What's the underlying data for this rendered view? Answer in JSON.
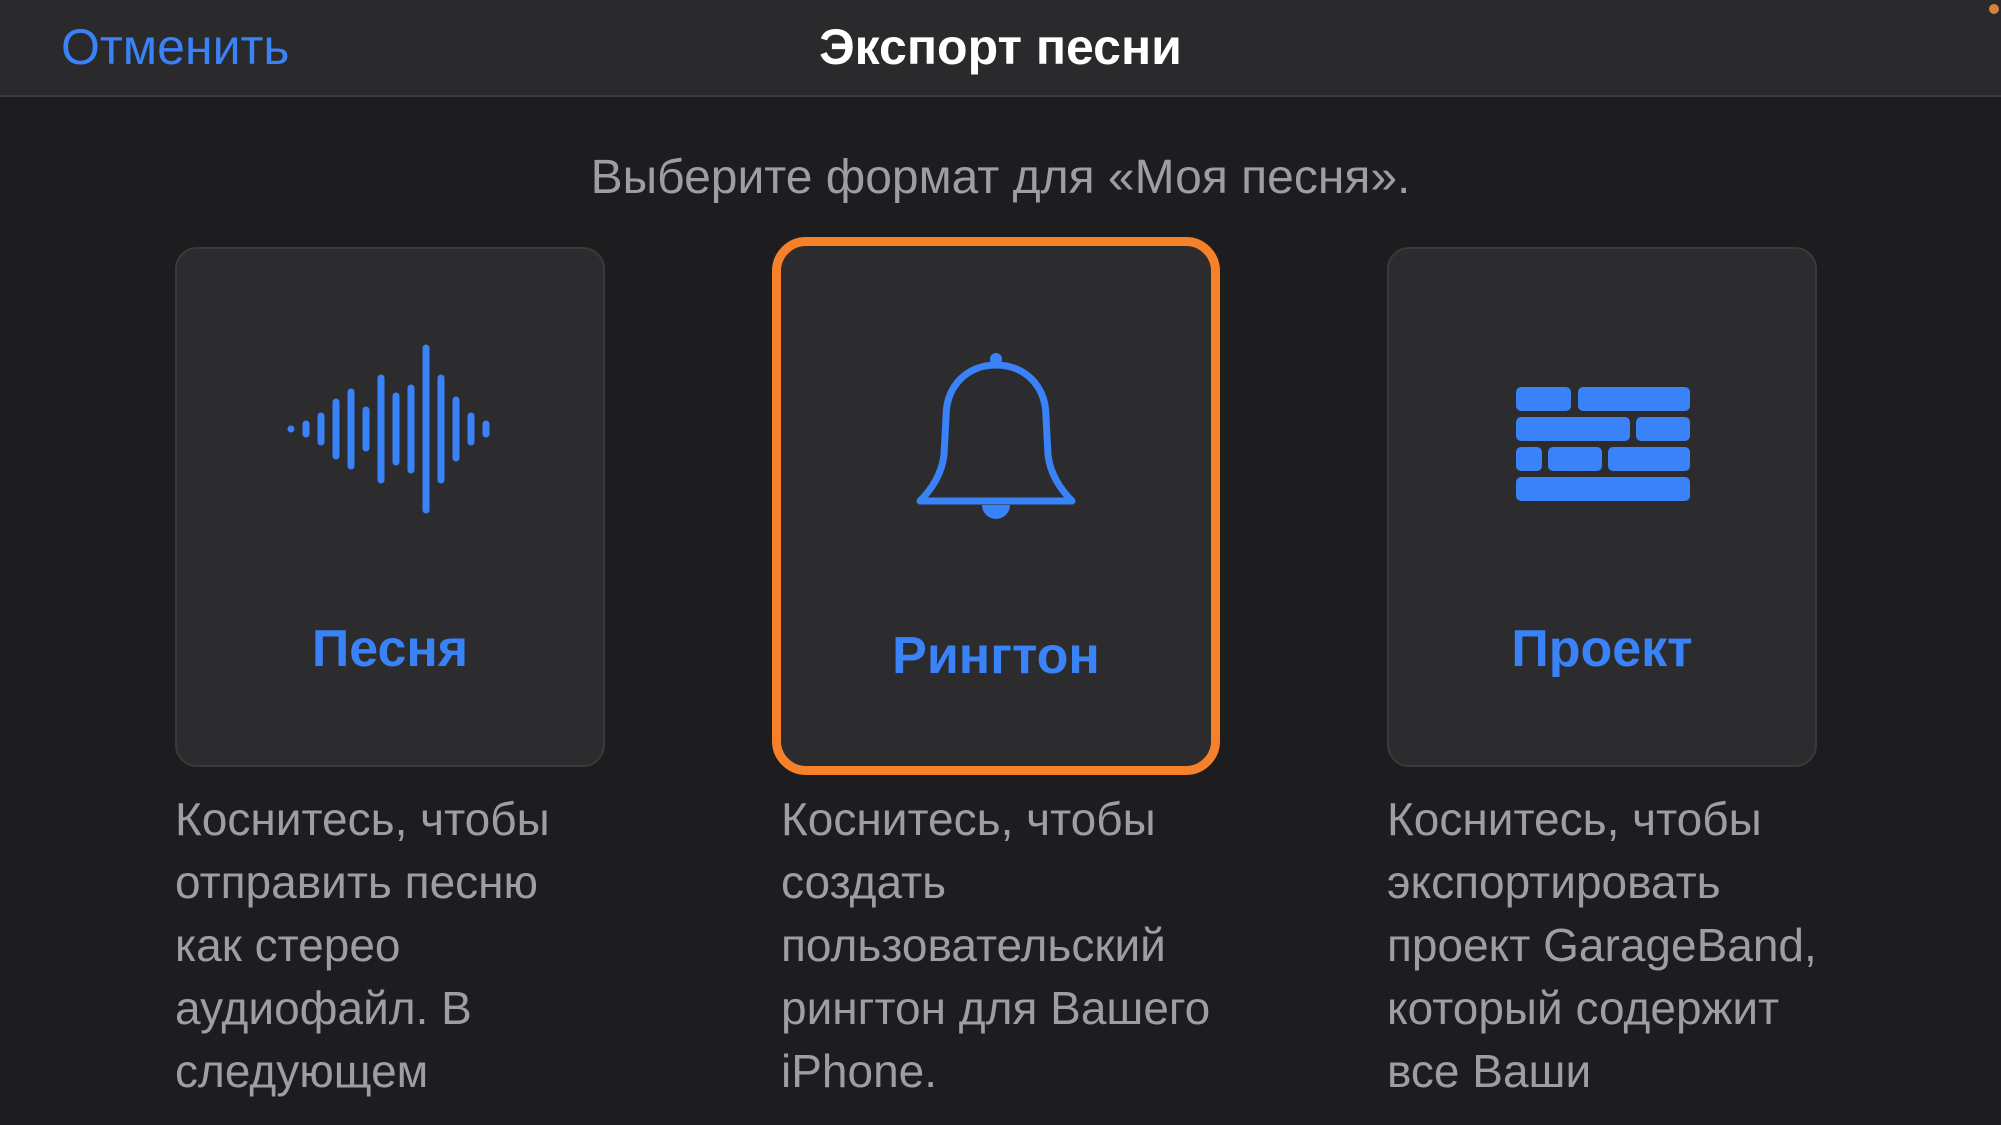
{
  "navbar": {
    "cancel_label": "Отменить",
    "title": "Экспорт песни"
  },
  "subtitle": "Выберите формат для «Моя песня».",
  "accent_color": "#3a82f7",
  "selected_color": "#f7812a",
  "options": [
    {
      "label": "Песня",
      "icon": "waveform-icon",
      "description": "Коснитесь, чтобы отправить песню как стерео аудиофайл. В следующем диалоговом окне"
    },
    {
      "label": "Рингтон",
      "icon": "bell-icon",
      "selected": true,
      "description": "Коснитесь, чтобы создать пользовательский рингтон для Вашего iPhone."
    },
    {
      "label": "Проект",
      "icon": "bricks-icon",
      "description": "Коснитесь, чтобы экспортировать проект GarageBand, который содержит все Ваши"
    }
  ]
}
